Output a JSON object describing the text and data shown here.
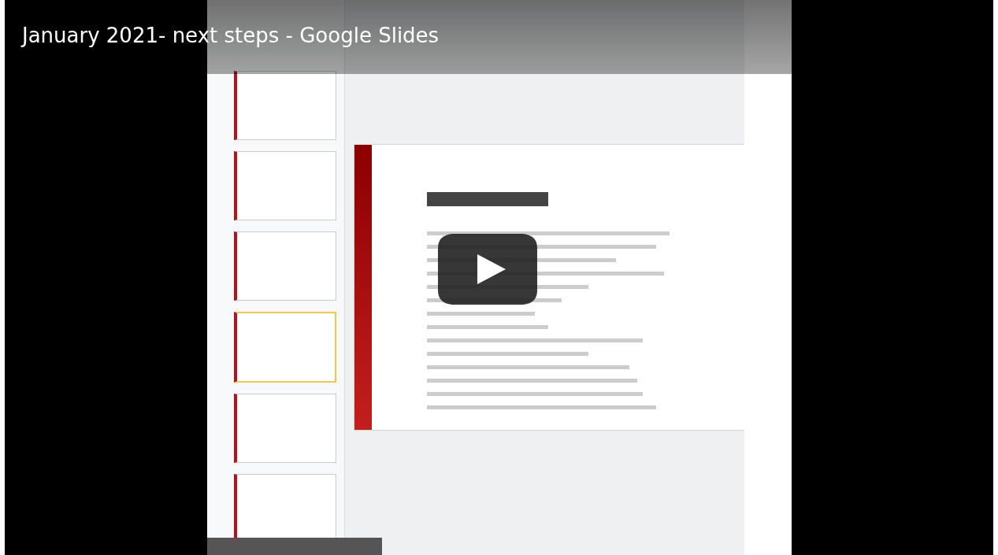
{
  "video": {
    "title": "January 2021- next steps - Google Slides"
  }
}
